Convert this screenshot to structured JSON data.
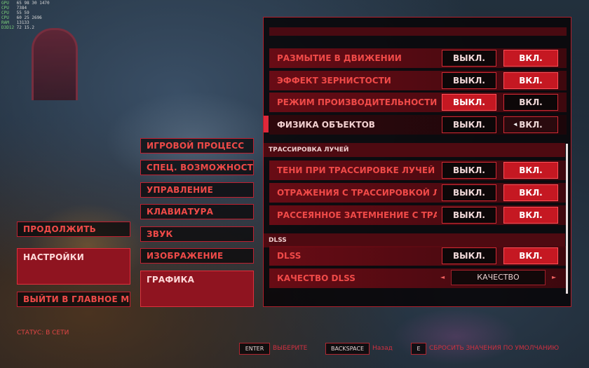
{
  "perf_overlay": [
    {
      "label": "GPU",
      "values": [
        "65",
        "98",
        "30",
        "1470"
      ]
    },
    {
      "label": "CPU",
      "values": [
        "7384"
      ]
    },
    {
      "label": "CPU",
      "values": [
        "55",
        "59"
      ]
    },
    {
      "label": "CPU",
      "values": [
        "60",
        "25",
        "2696"
      ]
    },
    {
      "label": "RAM",
      "values": [
        "13133"
      ]
    },
    {
      "label": "D3D12",
      "values": [
        "72",
        "15.2"
      ]
    }
  ],
  "left_menu": {
    "continue": "ПРОДОЛЖИТЬ",
    "settings": "НАСТРОЙКИ",
    "exit": "ВЫЙТИ В ГЛАВНОЕ МЕН"
  },
  "categories": [
    "ИГРОВОЙ ПРОЦЕСС",
    "СПЕЦ. ВОЗМОЖНОСТИ",
    "УПРАВЛЕНИЕ",
    "КЛАВИАТУРА",
    "ЗВУК",
    "ИЗОБРАЖЕНИЕ",
    "ГРАФИКА"
  ],
  "settings": {
    "off_label": "ВЫКЛ.",
    "on_label": "ВКЛ.",
    "rows": [
      {
        "label": "РАЗМЫТИЕ В ДВИЖЕНИИ",
        "value": "on"
      },
      {
        "label": "ЭФФЕКТ ЗЕРНИСТОСТИ",
        "value": "on"
      },
      {
        "label": "РЕЖИМ ПРОИЗВОДИТЕЛЬНОСТИ ПІ",
        "value": "off"
      },
      {
        "label": "ФИЗИКА ОБЪЕКТОВ",
        "value": "on"
      }
    ],
    "section_rt": "ТРАССИРОВКА ЛУЧЕЙ",
    "rt_rows": [
      {
        "label": "ТЕНИ ПРИ ТРАССИРОВКЕ ЛУЧЕЙ",
        "value": "on"
      },
      {
        "label": "ОТРАЖЕНИЯ С ТРАССИРОВКОЙ ЛУЧ",
        "value": "on"
      },
      {
        "label": "РАССЕЯННОЕ ЗАТЕМНЕНИЕ С ТРАСС",
        "value": "on"
      }
    ],
    "section_dlss": "DLSS",
    "dlss_row": {
      "label": "DLSS",
      "value": "on"
    },
    "quality_row": {
      "label": "КАЧЕСТВО DLSS",
      "value": "КАЧЕСТВО"
    }
  },
  "status": "СТАТУС: В СЕТИ",
  "hints": {
    "enter_key": "ENTER",
    "enter_action": "ВЫБЕРИТЕ",
    "backspace_key": "BACKSPACE",
    "backspace_action": "Назад",
    "e_key": "E",
    "e_action": "СБРОСИТЬ ЗНАЧЕНИЯ ПО УМОЛЧАНИЮ"
  },
  "colors": {
    "accent": "#c51822",
    "text": "#f04a48"
  }
}
